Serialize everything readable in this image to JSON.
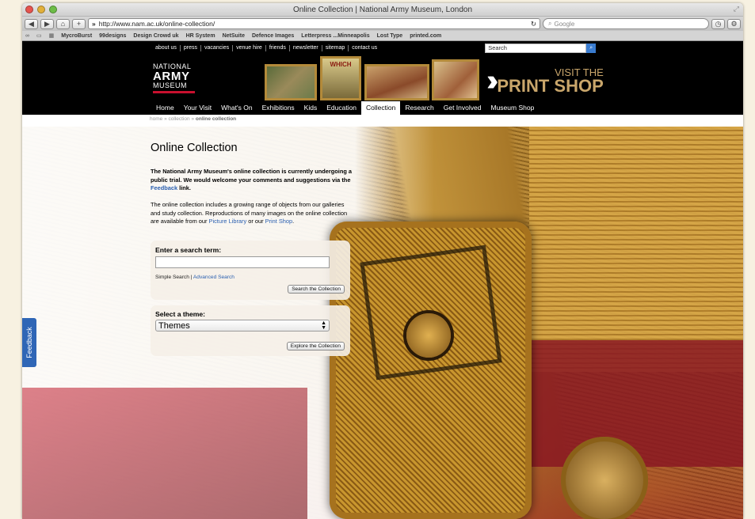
{
  "browser": {
    "title": "Online Collection | National Army Museum, London",
    "url": "http://www.nam.ac.uk/online-collection/",
    "search_placeholder": "Google",
    "bookmarks": [
      "MycroBurst",
      "99designs",
      "Design Crowd uk",
      "HR System",
      "NetSuite",
      "Defence Images",
      "Letterpress ...Minneapolis",
      "Lost Type",
      "printed.com"
    ]
  },
  "topnav": {
    "links": [
      "about us",
      "press",
      "vacancies",
      "venue hire",
      "friends",
      "newsletter",
      "sitemap",
      "contact us"
    ],
    "search_value": "Search"
  },
  "logo": {
    "line1": "NATIONAL",
    "line2": "ARMY",
    "line3": "MUSEUM"
  },
  "banner": {
    "painting_text": "WHICH",
    "print_line1": "VISIT THE",
    "print_line2": "PRINT SHOP"
  },
  "mainnav": {
    "items": [
      "Home",
      "Your Visit",
      "What's On",
      "Exhibitions",
      "Kids",
      "Education",
      "Collection",
      "Research",
      "Get Involved",
      "Museum Shop"
    ],
    "active": "Collection"
  },
  "breadcrumb": {
    "home": "home",
    "sep": "»",
    "collection": "collection",
    "current": "online collection"
  },
  "page": {
    "title": "Online Collection",
    "intro_a": "The National Army Museum's online collection is currently undergoing a public trial. We would welcome your comments and suggestions via the ",
    "intro_link": "Feedback",
    "intro_b": " link.",
    "body_a": "The online collection includes a growing range of objects from our galleries and study collection. Reproductions of many images on the online collection are available from our ",
    "body_link1": "Picture Library",
    "body_mid": " or our ",
    "body_link2": "Print Shop",
    "body_end": "."
  },
  "search": {
    "label": "Enter a search term:",
    "value": "",
    "simple": "Simple Search",
    "sep": " | ",
    "advanced": "Advanced Search",
    "button": "Search the Collection"
  },
  "theme": {
    "label": "Select a theme:",
    "selected": "Themes",
    "button": "Explore the Collection"
  },
  "feedback_tab": "Feedback",
  "colors": {
    "nav_bg": "#000000",
    "feedback_blue": "#2f66b6",
    "link": "#2a5fb0",
    "print_shop_gold": "#c9a66b",
    "logo_red": "#c8102e"
  }
}
